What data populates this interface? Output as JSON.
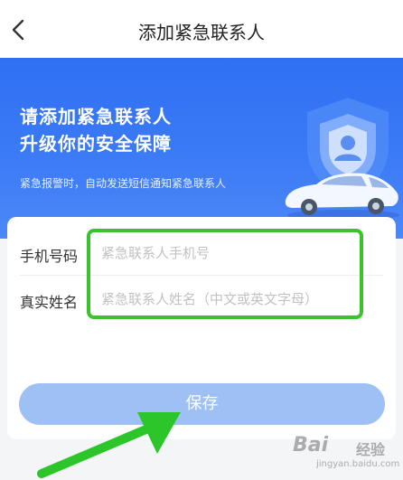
{
  "header": {
    "title": "添加紧急联系人",
    "back_icon": "chevron-left-icon"
  },
  "banner": {
    "title_line1": "请添加紧急联系人",
    "title_line2": "升级你的安全保障",
    "subtitle": "紧急报警时，自动发送短信通知紧急联系人",
    "colors": {
      "start": "#2f6ff3",
      "end": "#4c88f7"
    }
  },
  "form": {
    "phone_label": "手机号码",
    "phone_placeholder": "紧急联系人手机号",
    "phone_value": "",
    "name_label": "真实姓名",
    "name_placeholder": "紧急联系人姓名（中文或英文字母）",
    "name_value": ""
  },
  "actions": {
    "save_label": "保存",
    "save_color": "#9ec0f5"
  },
  "annotation": {
    "highlight_color": "#3bc22e"
  },
  "watermark": {
    "logo": "Bai",
    "text": "经验",
    "url": "jingyan.baidu.com"
  }
}
